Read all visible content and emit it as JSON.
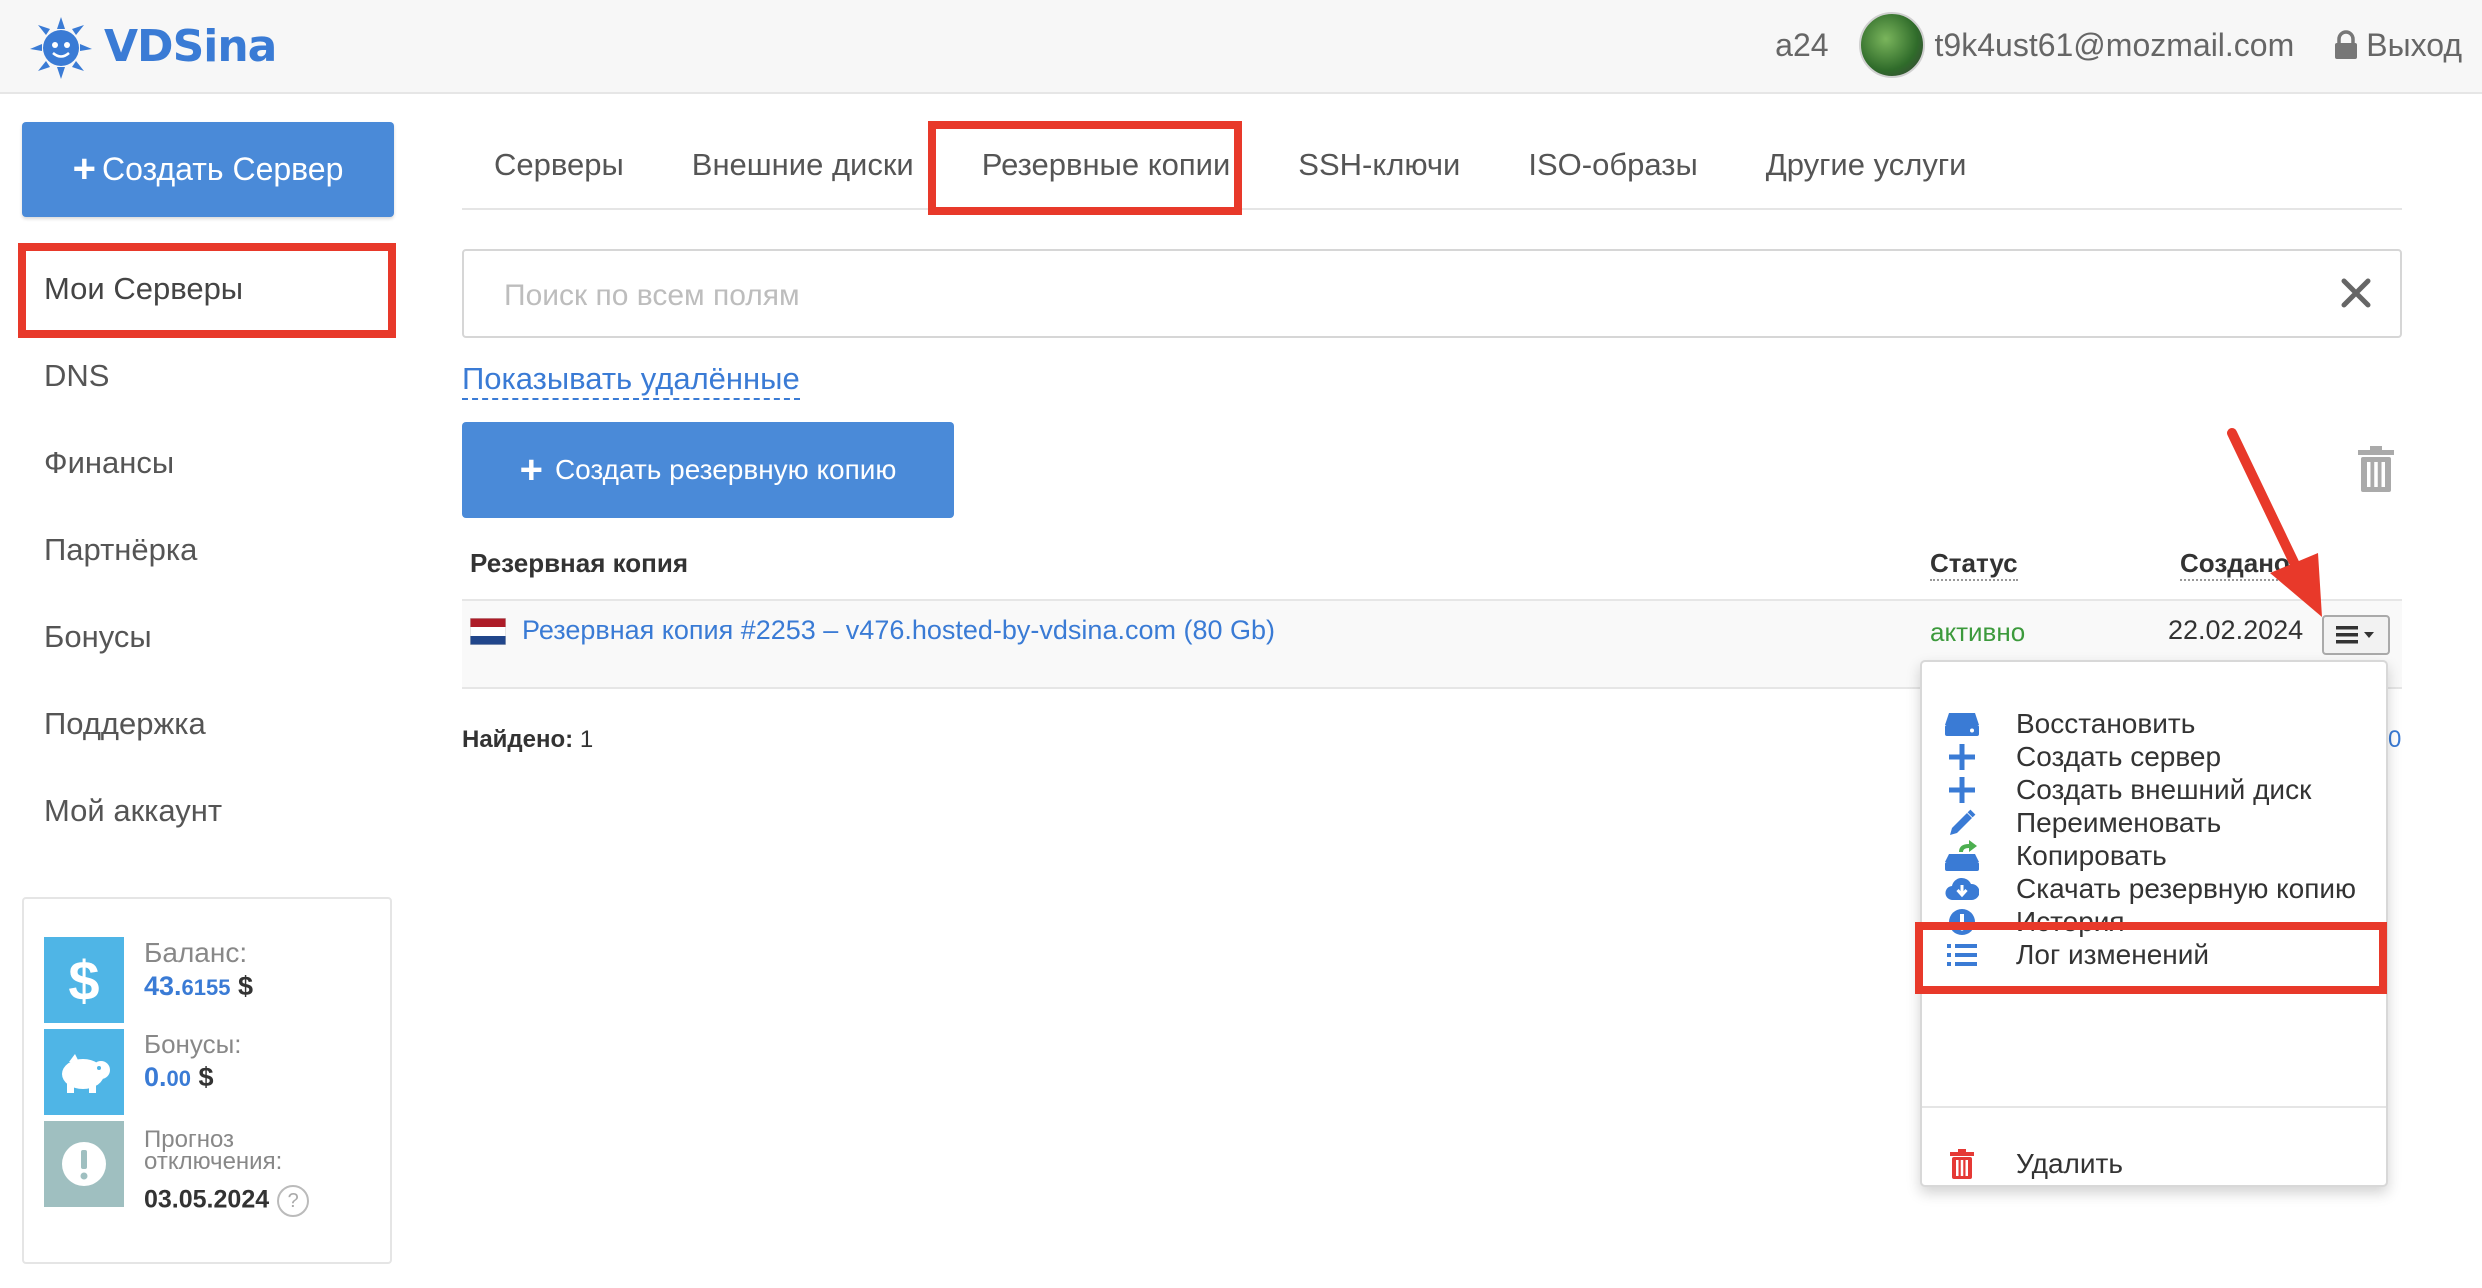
{
  "header": {
    "brand": "VDSina",
    "account_code": "a24",
    "email": "t9k4ust61@mozmail.com",
    "logout_label": "Выход"
  },
  "sidebar": {
    "create_server_label": "Создать Сервер",
    "items": [
      {
        "label": "Мои Серверы"
      },
      {
        "label": "DNS"
      },
      {
        "label": "Финансы"
      },
      {
        "label": "Партнёрка"
      },
      {
        "label": "Бонусы"
      },
      {
        "label": "Поддержка"
      },
      {
        "label": "Мой аккаунт"
      }
    ],
    "balance": {
      "label": "Баланс:",
      "value_main": "43.",
      "value_fraction": "6155",
      "currency": "$"
    },
    "bonuses": {
      "label": "Бонусы:",
      "value_main": "0.",
      "value_fraction": "00",
      "currency": "$"
    },
    "forecast": {
      "label_line1": "Прогноз",
      "label_line2": "отключения:",
      "date": "03.05.2024",
      "help": "?"
    }
  },
  "tabs": [
    {
      "label": "Серверы"
    },
    {
      "label": "Внешние диски"
    },
    {
      "label": "Резервные копии",
      "active": true
    },
    {
      "label": "SSH-ключи"
    },
    {
      "label": "ISO-образы"
    },
    {
      "label": "Другие услуги"
    }
  ],
  "search": {
    "placeholder": "Поиск по всем полям",
    "value": ""
  },
  "show_deleted_label": "Показывать удалённые",
  "create_backup_label": "Создать резервную копию",
  "table": {
    "columns": [
      "Резервная копия",
      "Статус",
      "Создано"
    ],
    "rows": [
      {
        "name": "Резервная копия #2253 – v476.hosted-by-vdsina.com (80 Gb)",
        "status": "активно",
        "created": "22.02.2024",
        "flag": "netherlands"
      }
    ],
    "found_label": "Найдено:",
    "found_count": "1",
    "pager_fragment": "0"
  },
  "dropdown": {
    "items": [
      {
        "label": "Восстановить",
        "icon": "drive-icon"
      },
      {
        "label": "Создать сервер",
        "icon": "plus-icon"
      },
      {
        "label": "Создать внешний диск",
        "icon": "plus-icon"
      },
      {
        "label": "Переименовать",
        "icon": "pencil-icon"
      },
      {
        "label": "Копировать",
        "icon": "copy-drive-icon"
      },
      {
        "label": "Скачать резервную копию",
        "icon": "cloud-download-icon"
      },
      {
        "label": "История",
        "icon": "exclamation-icon"
      },
      {
        "label": "Лог изменений",
        "icon": "list-icon"
      },
      {
        "label": "Удалить",
        "icon": "trash-icon"
      }
    ]
  },
  "colors": {
    "accent": "#4a8ad8",
    "link": "#3a7bd5",
    "status_active": "#3c9a3c",
    "highlight": "#e8392a"
  }
}
